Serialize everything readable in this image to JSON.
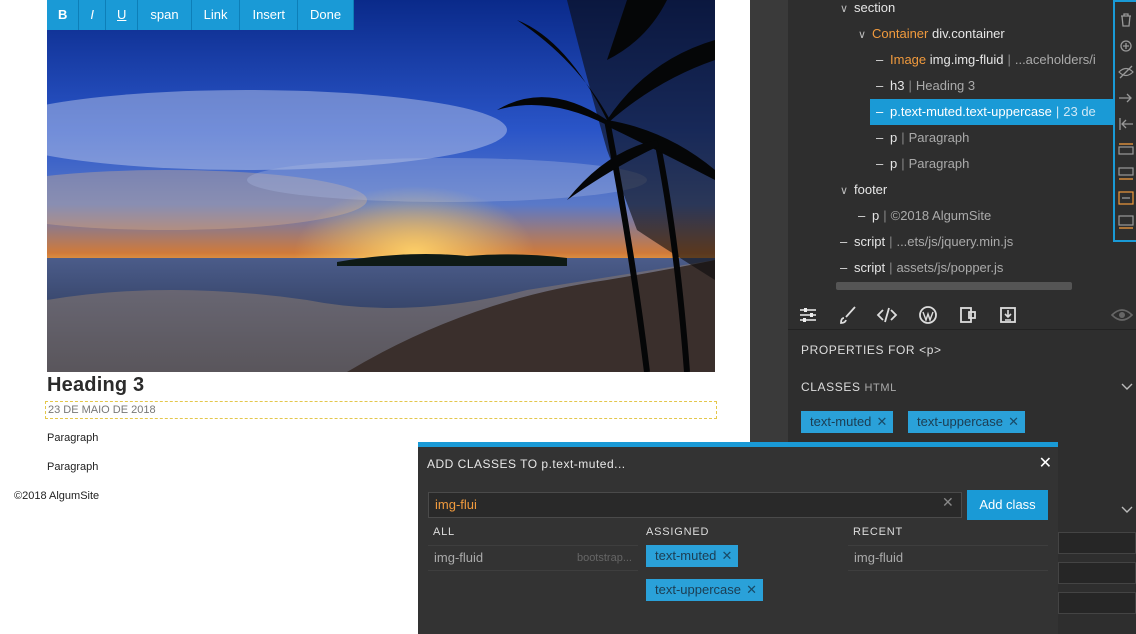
{
  "editor": {
    "toolbar": [
      "B",
      "I",
      "U",
      "span",
      "Link",
      "Insert",
      "Done"
    ],
    "heading": "Heading 3",
    "date_text": "23 DE MAIO DE 2018",
    "paragraph1": "Paragraph",
    "paragraph2": "Paragraph",
    "footer_text": "©2018 AlgumSite"
  },
  "tree": {
    "section": "section",
    "container_type": "Container",
    "container_name": "div.container",
    "image_type": "Image",
    "image_name": "img.img-fluid",
    "image_val": "...aceholders/i",
    "h3_name": "h3",
    "h3_val": "Heading 3",
    "p_muted_name": "p.text-muted.text-uppercase",
    "p_muted_val": "23 de",
    "p1_name": "p",
    "p1_val": "Paragraph",
    "p2_name": "p",
    "p2_val": "Paragraph",
    "footer": "footer",
    "footer_p_name": "p",
    "footer_p_val": "©2018 AlgumSite",
    "script1_name": "script",
    "script1_val": "...ets/js/jquery.min.js",
    "script2_name": "script",
    "script2_val": "assets/js/popper.js"
  },
  "properties": {
    "title": "PROPERTIES FOR <p>",
    "classes_label": "CLASSES",
    "classes_sub": "HTML",
    "classes": [
      "text-muted",
      "text-uppercase"
    ]
  },
  "dialog": {
    "title": "ADD CLASSES TO p.text-muted...",
    "input_value": "img-flui",
    "add_button": "Add class",
    "all_header": "ALL",
    "assigned_header": "ASSIGNED",
    "recent_header": "RECENT",
    "all_items": [
      {
        "name": "img-fluid",
        "source": "bootstrap..."
      }
    ],
    "assigned_items": [
      "text-muted",
      "text-uppercase"
    ],
    "recent_items": [
      "img-fluid"
    ]
  },
  "colors": {
    "accent": "#1a9ad6",
    "orange": "#f09a3d",
    "panel_bg": "#2e2e2e"
  }
}
